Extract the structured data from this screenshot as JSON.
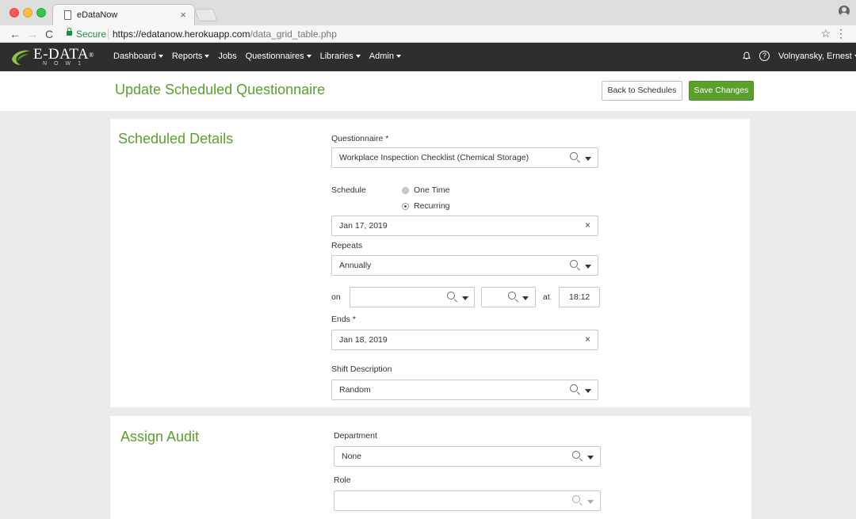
{
  "browser": {
    "tab_title": "eDataNow",
    "tab_close": "×",
    "secure_label": "Secure",
    "url_host": "https://edatanow.herokuapp.com",
    "url_path": "/data_grid_table.php",
    "icons": [
      "back-arrow-icon",
      "forward-arrow-icon",
      "reload-icon",
      "lock-icon",
      "star-icon",
      "menu-dots-icon",
      "profile-icon"
    ]
  },
  "app": {
    "logo_main": "E-DATA",
    "logo_reg": "®",
    "logo_sub": "NOW1",
    "nav": [
      {
        "label": "Dashboard",
        "has_caret": true
      },
      {
        "label": "Reports",
        "has_caret": true
      },
      {
        "label": "Jobs",
        "has_caret": false
      },
      {
        "label": "Questionnaires",
        "has_caret": true
      },
      {
        "label": "Libraries",
        "has_caret": true
      },
      {
        "label": "Admin",
        "has_caret": true
      }
    ],
    "user_name": "Volnyansky, Ernest",
    "accent_color": "#5aa02c",
    "nav_bg": "#2e2e2e"
  },
  "header": {
    "title": "Update Scheduled Questionnaire",
    "back_button": "Back to Schedules",
    "save_button": "Save Changes"
  },
  "scheduled": {
    "title": "Scheduled Details",
    "questionnaire_label": "Questionnaire *",
    "questionnaire_value": "Workplace Inspection Checklist (Chemical Storage)",
    "schedule_label": "Schedule",
    "schedule_options": [
      "One Time",
      "Recurring"
    ],
    "schedule_selected": "Recurring",
    "start_date": "Jan 17, 2019",
    "repeats_label": "Repeats",
    "repeats_value": "Annually",
    "on_label": "on",
    "at_label": "at",
    "on_month_value": "",
    "on_day_value": "",
    "time_value": "18:12",
    "ends_label": "Ends *",
    "ends_value": "Jan 18, 2019",
    "shift_label": "Shift Description",
    "shift_value": "Random"
  },
  "audit": {
    "title": "Assign Audit",
    "department_label": "Department",
    "department_value": "None",
    "role_label": "Role",
    "role_value": ""
  }
}
